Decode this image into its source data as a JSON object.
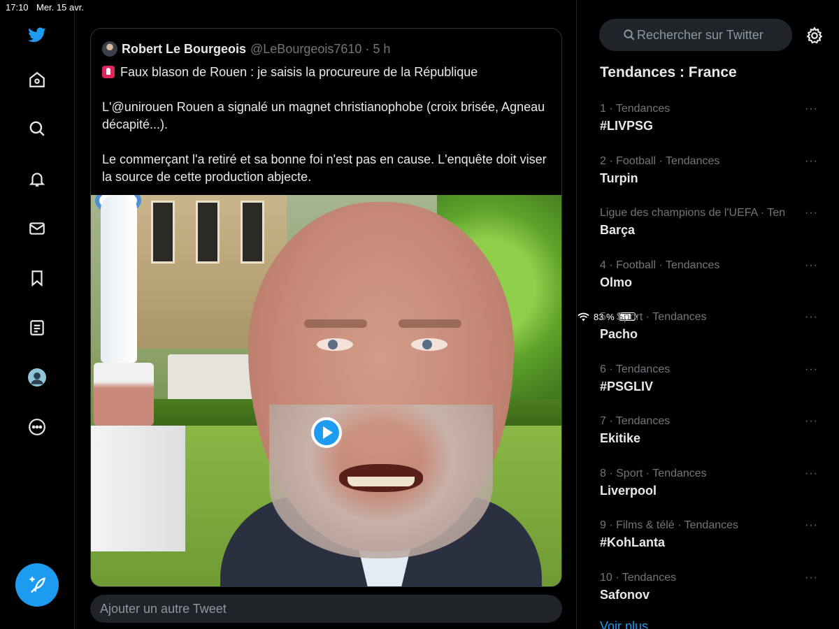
{
  "status_bar": {
    "time": "17:10",
    "date": "Mer. 15 avr.",
    "battery": "83 %",
    "battery_level": 0.83
  },
  "nav": {
    "icons": [
      "twitter-logo-icon",
      "home-icon",
      "search-icon",
      "bell-icon",
      "mail-icon",
      "bookmark-icon",
      "lists-icon",
      "profile-avatar",
      "more-icon"
    ],
    "compose": "compose-tweet-icon"
  },
  "tweet": {
    "author_name": "Robert Le Bourgeois",
    "author_meta": "@LeBourgeois7610 · 5 h",
    "line1": "Faux blason de Rouen : je saisis la procureure de la République",
    "line2": "L'@unirouen Rouen a signalé un magnet christianophobe (croix brisée, Agneau décapité...).",
    "line3": "Le commerçant l'a retiré et sa bonne foi n'est pas en cause. L'enquête doit viser la source de cette production abjecte."
  },
  "reply_placeholder": "Ajouter un autre Tweet",
  "search_placeholder": "Rechercher sur Twitter",
  "trends_title": "Tendances : France",
  "trends": [
    {
      "meta": "1 · Tendances",
      "name": "#LIVPSG"
    },
    {
      "meta": "2 · Football · Tendances",
      "name": "Turpin"
    },
    {
      "meta": "Ligue des champions de l'UEFA · Ten",
      "name": "Barça"
    },
    {
      "meta": "4 · Football · Tendances",
      "name": "Olmo"
    },
    {
      "meta": "5 · Sport · Tendances",
      "name": "Pacho"
    },
    {
      "meta": "6 · Tendances",
      "name": "#PSGLIV"
    },
    {
      "meta": "7 · Tendances",
      "name": "Ekitike"
    },
    {
      "meta": "8 · Sport · Tendances",
      "name": "Liverpool"
    },
    {
      "meta": "9 · Films & télé · Tendances",
      "name": "#KohLanta"
    },
    {
      "meta": "10 · Tendances",
      "name": "Safonov"
    }
  ],
  "more_label": "···",
  "see_more": "Voir plus",
  "colors": {
    "accent": "#1d9bf0",
    "background": "#000000",
    "muted": "#71767b"
  }
}
